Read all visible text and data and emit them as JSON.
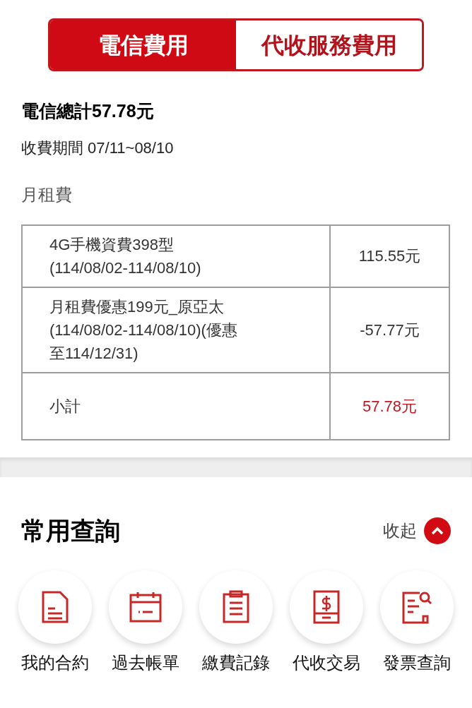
{
  "tabs": [
    {
      "label": "電信費用",
      "selected": true
    },
    {
      "label": "代收服務費用",
      "selected": false
    }
  ],
  "summary": {
    "total": "電信總計57.78元",
    "period": "收費期間 07/11~08/10",
    "section": "月租費"
  },
  "table": {
    "rows": [
      {
        "kind": "item",
        "lines": [
          "4G手機資費398型",
          "(114/08/02-114/08/10)"
        ],
        "amount": "115.55元"
      },
      {
        "kind": "item",
        "lines": [
          "月租費優惠199元_原亞太",
          "(114/08/02-114/08/10)(優惠",
          "至114/12/31)"
        ],
        "amount": "-57.77元"
      },
      {
        "kind": "subtotal",
        "lines": [
          "小計"
        ],
        "amount": "57.78元"
      }
    ]
  },
  "quick": {
    "title": "常用查詢",
    "toggle": {
      "label": "收起",
      "expanded": true
    },
    "items": [
      {
        "kind": "document",
        "label": "我的合約"
      },
      {
        "kind": "calendar",
        "label": "過去帳單"
      },
      {
        "kind": "clipboard",
        "label": "繳費記錄"
      },
      {
        "kind": "payment",
        "label": "代收交易"
      },
      {
        "kind": "invoice",
        "label": "發票查詢"
      }
    ]
  }
}
